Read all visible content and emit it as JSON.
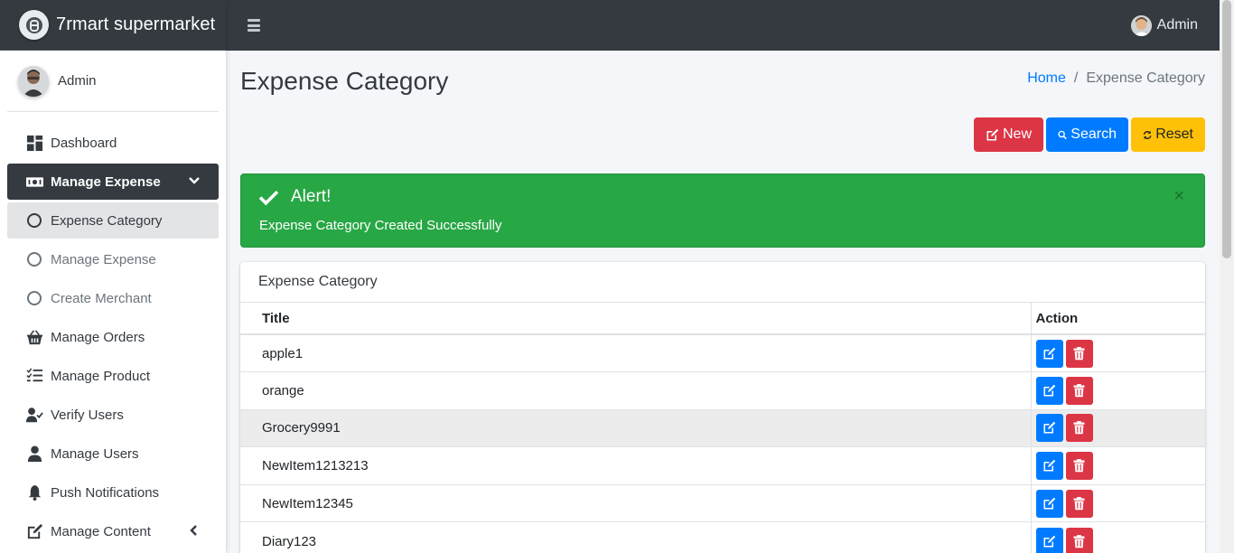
{
  "brand": {
    "name": "7rmart supermarket"
  },
  "sidebar": {
    "user_name": "Admin",
    "items": [
      {
        "label": "Dashboard",
        "icon": "dashboard-icon"
      },
      {
        "label": "Manage Expense",
        "icon": "money-bill-icon"
      },
      {
        "label": "Expense Category",
        "icon": "circle-icon"
      },
      {
        "label": "Manage Expense",
        "icon": "circle-icon"
      },
      {
        "label": "Create Merchant",
        "icon": "circle-icon"
      },
      {
        "label": "Manage Orders",
        "icon": "shopping-basket-icon"
      },
      {
        "label": "Manage Product",
        "icon": "tasks-icon"
      },
      {
        "label": "Verify Users",
        "icon": "user-check-icon"
      },
      {
        "label": "Manage Users",
        "icon": "user-icon"
      },
      {
        "label": "Push Notifications",
        "icon": "bell-icon"
      },
      {
        "label": "Manage Content",
        "icon": "edit-icon"
      }
    ]
  },
  "navbar": {
    "user_name": "Admin"
  },
  "page": {
    "title": "Expense Category",
    "breadcrumb": {
      "home": "Home",
      "current": "Expense Category"
    }
  },
  "toolbar": {
    "new_label": "New",
    "search_label": "Search",
    "reset_label": "Reset"
  },
  "alert": {
    "title": "Alert!",
    "message": "Expense Category Created Successfully",
    "close": "×",
    "color": "#28a745"
  },
  "table": {
    "card_title": "Expense Category",
    "headers": {
      "title": "Title",
      "action": "Action"
    },
    "rows": [
      {
        "title": "apple1"
      },
      {
        "title": "orange"
      },
      {
        "title": "Grocery9991"
      },
      {
        "title": "NewItem1213213"
      },
      {
        "title": "NewItem12345"
      },
      {
        "title": "Diary123"
      }
    ]
  },
  "colors": {
    "primary": "#007bff",
    "danger": "#dc3545",
    "warning": "#ffc107",
    "dark": "#343a40"
  }
}
